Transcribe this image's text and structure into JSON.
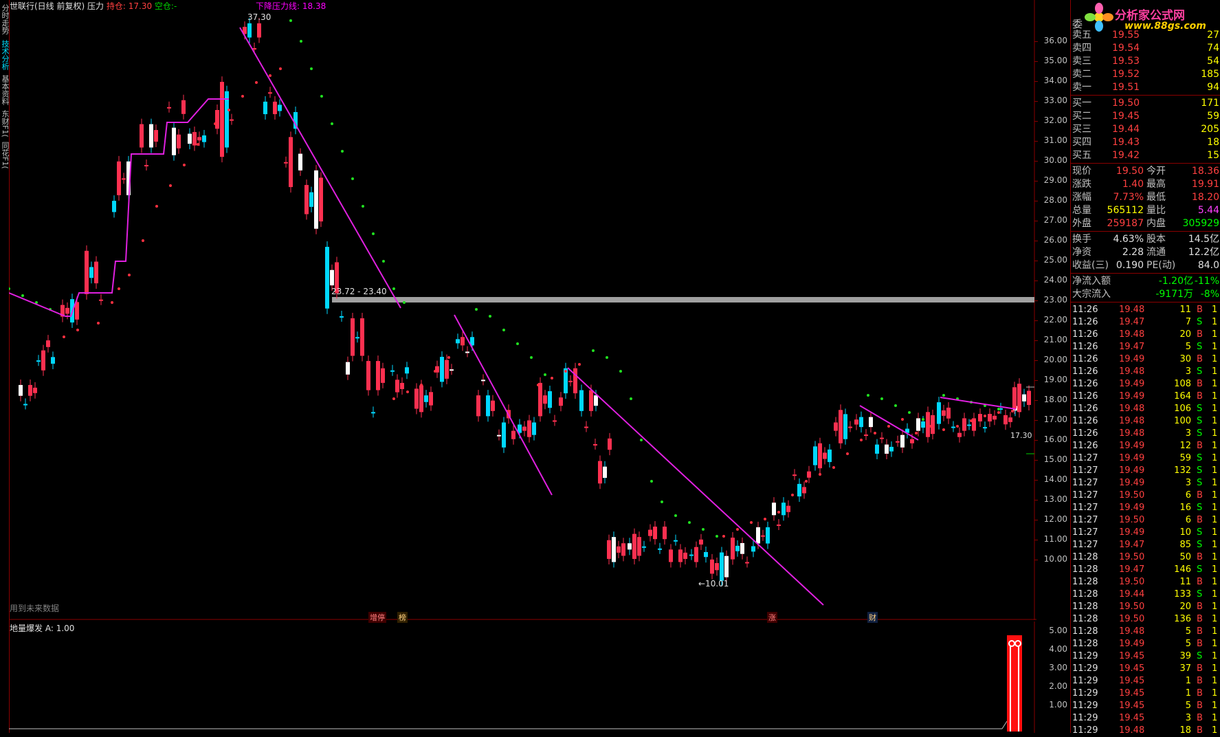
{
  "header": {
    "stock_name": "世联行(日线 前复权)",
    "indicator": "压力",
    "hold_label": "持仓:",
    "hold_value": "17.30",
    "empty_label": "空仓:",
    "empty_value": "-",
    "resistance_label": "下降压力线: 18.38"
  },
  "left_tabs": [
    "分时走势",
    "技术分析",
    "基本资料",
    "东财F1(",
    "同花F1("
  ],
  "annotations": {
    "high": "37.30",
    "range": "23.72 - 23.40",
    "low": "←10.01",
    "right_price": "17.30"
  },
  "future_note": "用到未来数据",
  "event_markers": [
    "增停",
    "榜",
    "涨",
    "财"
  ],
  "sub_indicator": {
    "name": "地量爆发",
    "value": "A: 1.00"
  },
  "price_ticks": [
    "36.00",
    "35.00",
    "34.00",
    "33.00",
    "32.00",
    "31.00",
    "30.00",
    "29.00",
    "28.00",
    "27.00",
    "26.00",
    "25.00",
    "24.00",
    "23.00",
    "22.00",
    "21.00",
    "20.00",
    "19.00",
    "18.00",
    "17.00",
    "16.00",
    "15.00",
    "14.00",
    "13.00",
    "12.00",
    "11.00",
    "10.00"
  ],
  "sub_ticks": [
    "5.00",
    "4.00",
    "3.00",
    "2.00",
    "1.00"
  ],
  "logo": {
    "title": "分析家公式网",
    "url": "www.88gs.com"
  },
  "order_book": {
    "header_label": "委",
    "sells": [
      {
        "label": "卖五",
        "price": "19.55",
        "vol": "27"
      },
      {
        "label": "卖四",
        "price": "19.54",
        "vol": "74"
      },
      {
        "label": "卖三",
        "price": "19.53",
        "vol": "54"
      },
      {
        "label": "卖二",
        "price": "19.52",
        "vol": "185"
      },
      {
        "label": "卖一",
        "price": "19.51",
        "vol": "94"
      }
    ],
    "buys": [
      {
        "label": "买一",
        "price": "19.50",
        "vol": "171"
      },
      {
        "label": "买二",
        "price": "19.45",
        "vol": "59"
      },
      {
        "label": "买三",
        "price": "19.44",
        "vol": "205"
      },
      {
        "label": "买四",
        "price": "19.43",
        "vol": "18"
      },
      {
        "label": "买五",
        "price": "19.42",
        "vol": "15"
      }
    ]
  },
  "quote": [
    {
      "l1": "现价",
      "v1": "19.50",
      "l2": "今开",
      "v2": "18.36"
    },
    {
      "l1": "涨跌",
      "v1": "1.40",
      "l2": "最高",
      "v2": "19.91"
    },
    {
      "l1": "涨幅",
      "v1": "7.73%",
      "l2": "最低",
      "v2": "18.20"
    },
    {
      "l1": "总量",
      "v1": "565112",
      "l2": "量比",
      "v2": "5.44"
    },
    {
      "l1": "外盘",
      "v1": "259187",
      "l2": "内盘",
      "v2": "305929"
    }
  ],
  "fundamentals": [
    {
      "l1": "换手",
      "v1": "4.63%",
      "l2": "股本",
      "v2": "14.5亿"
    },
    {
      "l1": "净资",
      "v1": "2.28",
      "l2": "流通",
      "v2": "12.2亿"
    },
    {
      "l1": "收益(三)",
      "v1": "0.190",
      "l2": "PE(动)",
      "v2": "84.0"
    }
  ],
  "flows": [
    {
      "label": "净流入额",
      "value": "-1.20亿",
      "pct": "-11%"
    },
    {
      "label": "大宗流入",
      "value": "-9171万",
      "pct": "-8%"
    }
  ],
  "ticks": [
    [
      "11:26",
      "19.48",
      "11",
      "B",
      "1"
    ],
    [
      "11:26",
      "19.47",
      "7",
      "S",
      "1"
    ],
    [
      "11:26",
      "19.48",
      "20",
      "B",
      "1"
    ],
    [
      "11:26",
      "19.47",
      "5",
      "S",
      "1"
    ],
    [
      "11:26",
      "19.49",
      "30",
      "B",
      "1"
    ],
    [
      "11:26",
      "19.48",
      "3",
      "S",
      "1"
    ],
    [
      "11:26",
      "19.49",
      "108",
      "B",
      "1"
    ],
    [
      "11:26",
      "19.49",
      "164",
      "B",
      "1"
    ],
    [
      "11:26",
      "19.48",
      "106",
      "S",
      "1"
    ],
    [
      "11:26",
      "19.48",
      "100",
      "S",
      "1"
    ],
    [
      "11:26",
      "19.48",
      "3",
      "S",
      "1"
    ],
    [
      "11:26",
      "19.49",
      "12",
      "B",
      "1"
    ],
    [
      "11:27",
      "19.49",
      "59",
      "S",
      "1"
    ],
    [
      "11:27",
      "19.49",
      "132",
      "S",
      "1"
    ],
    [
      "11:27",
      "19.49",
      "3",
      "S",
      "1"
    ],
    [
      "11:27",
      "19.50",
      "6",
      "B",
      "1"
    ],
    [
      "11:27",
      "19.49",
      "16",
      "S",
      "1"
    ],
    [
      "11:27",
      "19.50",
      "6",
      "B",
      "1"
    ],
    [
      "11:27",
      "19.49",
      "10",
      "S",
      "1"
    ],
    [
      "11:27",
      "19.47",
      "85",
      "S",
      "1"
    ],
    [
      "11:28",
      "19.50",
      "50",
      "B",
      "1"
    ],
    [
      "11:28",
      "19.47",
      "146",
      "S",
      "1"
    ],
    [
      "11:28",
      "19.50",
      "11",
      "B",
      "1"
    ],
    [
      "11:28",
      "19.44",
      "133",
      "S",
      "1"
    ],
    [
      "11:28",
      "19.50",
      "20",
      "B",
      "1"
    ],
    [
      "11:28",
      "19.50",
      "136",
      "B",
      "1"
    ],
    [
      "11:28",
      "19.48",
      "5",
      "B",
      "1"
    ],
    [
      "11:28",
      "19.49",
      "5",
      "B",
      "1"
    ],
    [
      "11:29",
      "19.45",
      "39",
      "S",
      "1"
    ],
    [
      "11:29",
      "19.45",
      "37",
      "B",
      "1"
    ],
    [
      "11:29",
      "19.45",
      "1",
      "B",
      "1"
    ],
    [
      "11:29",
      "19.45",
      "1",
      "B",
      "1"
    ],
    [
      "11:29",
      "19.45",
      "5",
      "B",
      "1"
    ],
    [
      "11:29",
      "19.45",
      "3",
      "B",
      "1"
    ],
    [
      "11:29",
      "19.48",
      "18",
      "B",
      "1"
    ]
  ],
  "colors": {
    "up": "#ff3050",
    "down": "#00d8ff",
    "border": "#8a0000",
    "accent": "#ff00ff"
  }
}
